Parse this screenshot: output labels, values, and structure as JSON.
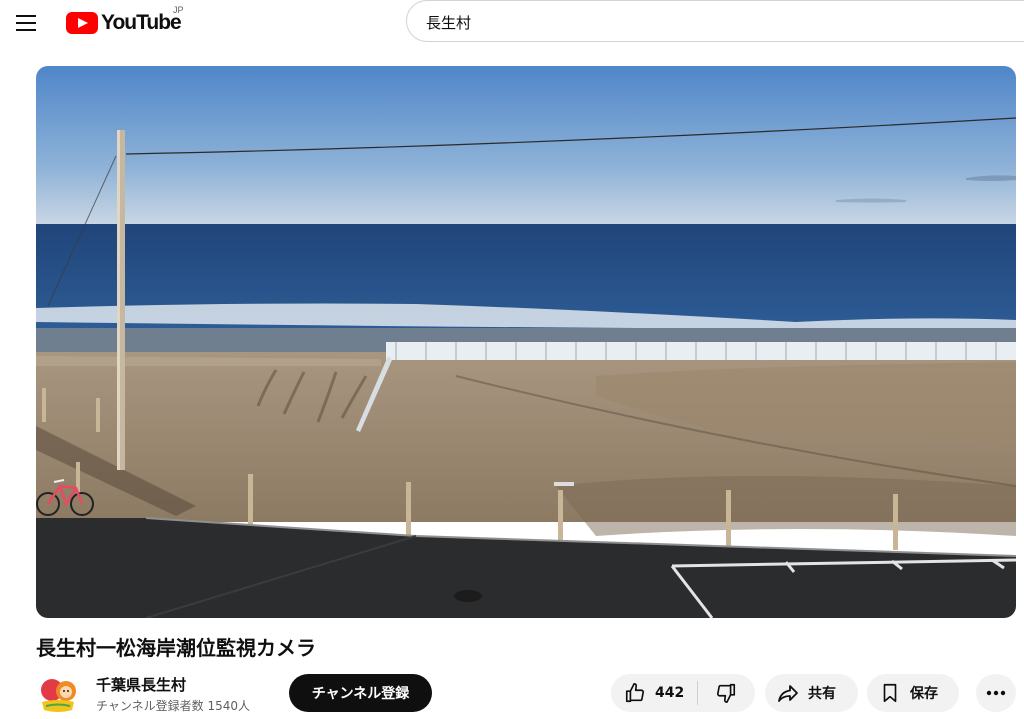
{
  "header": {
    "logo_text": "YouTube",
    "region": "JP",
    "search_value": "長生村"
  },
  "video": {
    "title": "長生村一松海岸潮位監視カメラ"
  },
  "channel": {
    "name": "千葉県長生村",
    "subscribers": "チャンネル登録者数 1540人",
    "subscribe_label": "チャンネル登録"
  },
  "actions": {
    "like_count": "442",
    "share_label": "共有",
    "save_label": "保存"
  },
  "icons": {
    "menu": "hamburger-menu-icon",
    "like": "thumbs-up-icon",
    "dislike": "thumbs-down-icon",
    "share": "share-arrow-icon",
    "save": "bookmark-icon",
    "more": "more-horizontal-icon"
  },
  "colors": {
    "brand_red": "#ff0000",
    "subscribe_bg": "#0f0f0f",
    "pill_bg": "#f2f2f2"
  }
}
